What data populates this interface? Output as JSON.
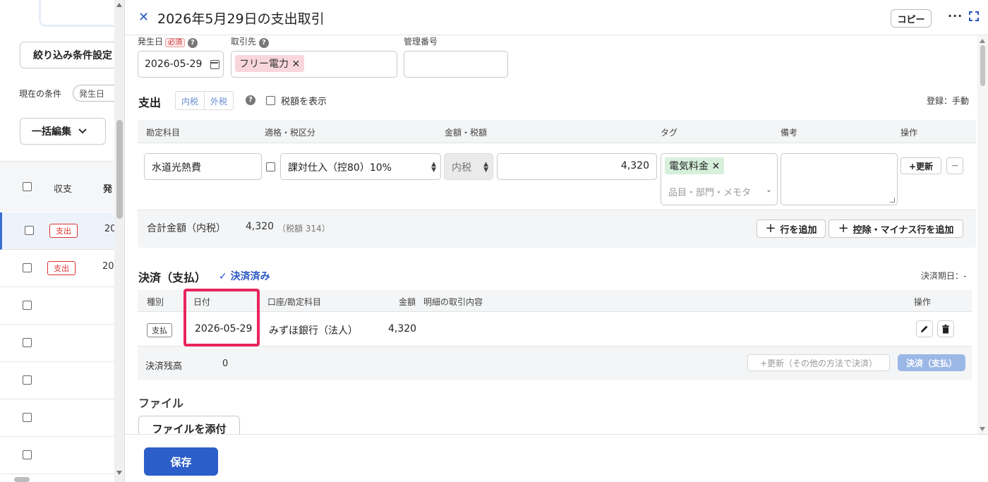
{
  "left_list": {
    "filter_button": "絞り込み条件設定",
    "current_condition_label": "現在の条件",
    "condition_chip": "発生日",
    "bulk_edit_button": "一括編集",
    "header_col_type": "収支",
    "header_col_date": "発",
    "rows": [
      {
        "badge": "支出",
        "year": "20"
      },
      {
        "badge": "支出",
        "year": "20"
      }
    ]
  },
  "header": {
    "title": "2026年5月29日の支出取引",
    "copy_button": "コピー",
    "more_icon": "more-horizontal-icon",
    "expand_icon": "expand-icon"
  },
  "top_fields": {
    "date_label": "発生日",
    "required_badge": "必須",
    "date_value": "2026-05-29",
    "partner_label": "取引先",
    "partner_tag": "フリー電力",
    "mgmt_label": "管理番号"
  },
  "expense": {
    "title": "支出",
    "tax_in": "内税",
    "tax_out": "外税",
    "show_tax_label": "税額を表示",
    "registration": "登録：手動",
    "columns": {
      "account": "勘定科目",
      "qualification": "適格・税区分",
      "amount": "金額・税額",
      "tag": "タグ",
      "memo": "備考",
      "action": "操作"
    },
    "row": {
      "account": "水道光熱費",
      "tax_category": "課対仕入（控80）10%",
      "tax_mode": "内税",
      "amount": "4,320",
      "tag": "電気料金",
      "tag_placeholder": "品目・部門・メモタ",
      "update_button": "+更新",
      "remove_button": "−"
    },
    "total_label": "合計金額（内税）",
    "total_value": "4,320",
    "total_tax": "（税額 314）",
    "add_row_button": "行を追加",
    "add_deduction_button": "控除・マイナス行を追加"
  },
  "settlement": {
    "title": "決済（支払）",
    "status": "決済済み",
    "due_label": "決済期日：-",
    "columns": {
      "kind": "種別",
      "date": "日付",
      "account": "口座/勘定科目",
      "amount": "金額",
      "detail": "明細の取引内容",
      "action": "操作"
    },
    "row": {
      "kind": "支払",
      "date": "2026-05-29",
      "account": "みずほ銀行（法人）",
      "amount": "4,320"
    },
    "balance_label": "決済残高",
    "balance_value": "0",
    "other_method_button": "+更新（その他の方法で決済）",
    "pay_button": "決済（支払）"
  },
  "files": {
    "title": "ファイル",
    "attach_button": "ファイルを添付"
  },
  "footer": {
    "save_button": "保存"
  },
  "colors": {
    "accent": "#2c5ec9",
    "highlight": "#e8255d",
    "expense_badge": "#d33333"
  }
}
